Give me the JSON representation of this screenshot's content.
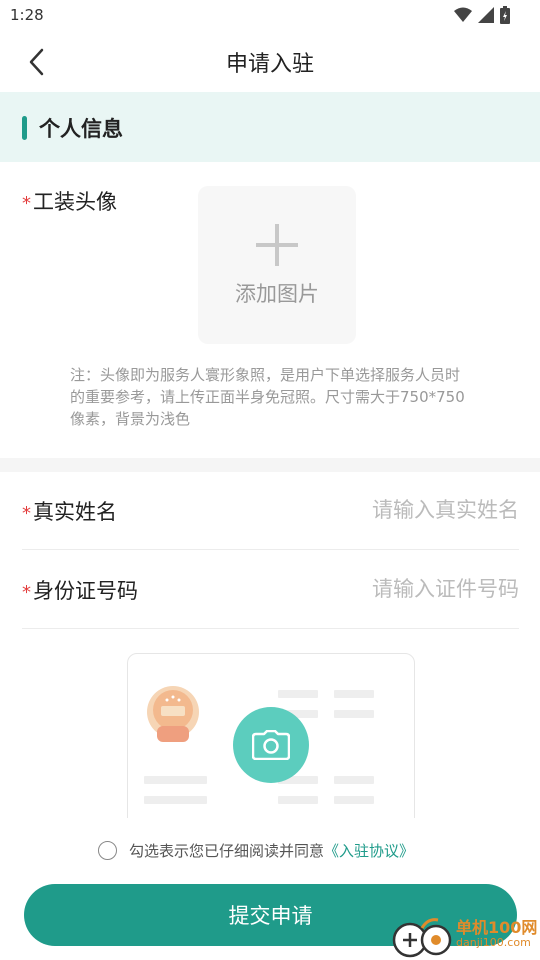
{
  "status_bar": {
    "time": "1:28"
  },
  "nav": {
    "title": "申请入驻"
  },
  "section": {
    "title": "个人信息"
  },
  "avatar": {
    "required_mark": "*",
    "label": "工装头像",
    "upload_text": "添加图片",
    "note": "注：头像即为服务人寰形象照，是用户下单选择服务人员时的重要参考，请上传正面半身免冠照。尺寸需大于750*750像素，背景为浅色"
  },
  "form": {
    "name": {
      "required_mark": "*",
      "label": "真实姓名",
      "placeholder": "请输入真实姓名"
    },
    "id_number": {
      "required_mark": "*",
      "label": "身份证号码",
      "placeholder": "请输入证件号码"
    }
  },
  "agreement": {
    "text": "勾选表示您已仔细阅读并同意",
    "link": "《入驻协议》"
  },
  "submit": {
    "label": "提交申请"
  },
  "watermark": {
    "line1": "单机100网",
    "line2": "danji100.com"
  },
  "colors": {
    "accent": "#1f9b8a",
    "section_bg": "#e9f6f4",
    "camera": "#5ccdbe",
    "required": "#e33c3c"
  }
}
